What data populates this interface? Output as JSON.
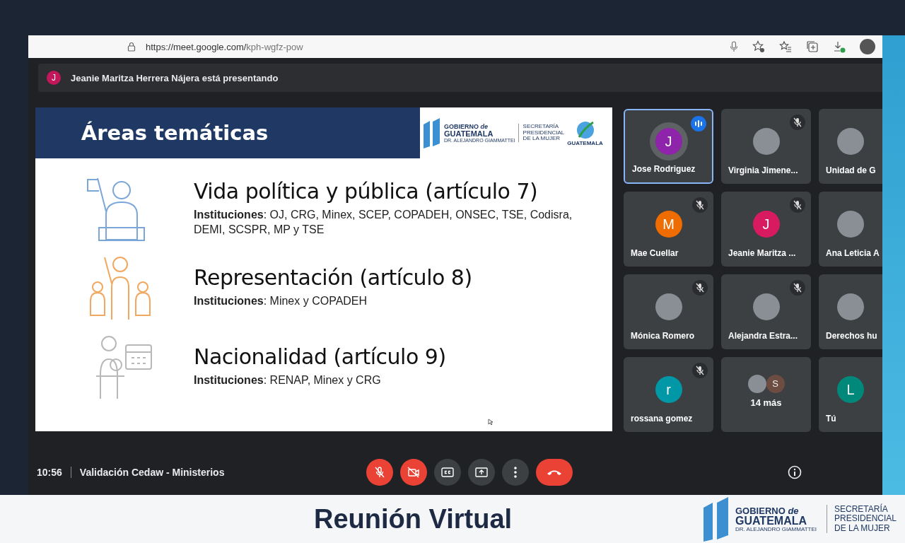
{
  "browser": {
    "url_host": "https://meet.google.com/",
    "url_path": "kph-wgfz-pow"
  },
  "presenter": {
    "initial": "J",
    "color": "#c2185b",
    "text": "Jeanie Maritza Herrera Nájera está presentando"
  },
  "slide": {
    "title": "Áreas temáticas",
    "logo": {
      "line1": "GOBIERNO *de*",
      "line2": "GUATEMALA",
      "line3": "DR. ALEJANDRO GIAMMATTEI",
      "secretaria": [
        "SECRETARÍA",
        "PRESIDENCIAL",
        "DE LA MUJER"
      ],
      "bicentenario": "GUATEMALA"
    },
    "topics": [
      {
        "kind": "politics",
        "heading": "Vida política y pública (artículo 7)",
        "institutions": "**Instituciones**: OJ, CRG, Minex, SCEP, COPADEH, ONSEC, TSE, Codisra, DEMI, SCSPR, MP y TSE"
      },
      {
        "kind": "representation",
        "heading": "Representación (artículo 8)",
        "institutions": "**Instituciones**: Minex y COPADEH"
      },
      {
        "kind": "nationality",
        "heading": "Nacionalidad (artículo 9)",
        "institutions": "**Instituciones**: RENAP, Minex y CRG"
      }
    ]
  },
  "tiles": [
    {
      "kind": "initial",
      "name": "Jose Rodriguez",
      "initial": "J",
      "color": "#8e24aa",
      "muted": false,
      "speaking": true,
      "selected": true
    },
    {
      "kind": "photo",
      "name": "Virginia Jimene...",
      "muted": true,
      "speaking": false,
      "selected": false
    },
    {
      "kind": "photo",
      "name": "Unidad de G",
      "muted": false,
      "speaking": false,
      "selected": false
    },
    {
      "kind": "initial",
      "name": "Mae Cuellar",
      "initial": "M",
      "color": "#ef6c00",
      "muted": true,
      "speaking": false,
      "selected": false
    },
    {
      "kind": "initial",
      "name": "Jeanie Maritza ...",
      "initial": "J",
      "color": "#d81b60",
      "muted": true,
      "speaking": false,
      "selected": false
    },
    {
      "kind": "photo",
      "name": "Ana Leticia A",
      "muted": false,
      "speaking": false,
      "selected": false
    },
    {
      "kind": "photo",
      "name": "Mónica Romero",
      "muted": true,
      "speaking": false,
      "selected": false
    },
    {
      "kind": "photo",
      "name": "Alejandra Estra...",
      "muted": true,
      "speaking": false,
      "selected": false
    },
    {
      "kind": "photo",
      "name": "Derechos hu",
      "muted": false,
      "speaking": false,
      "selected": false
    },
    {
      "kind": "initial",
      "name": "rossana gomez",
      "initial": "r",
      "color": "#0097a7",
      "muted": true,
      "speaking": false,
      "selected": false
    },
    {
      "kind": "more",
      "name": "14 más",
      "initial": "S",
      "color": "#6d4c41",
      "muted": false,
      "speaking": false,
      "selected": false
    },
    {
      "kind": "initial",
      "name": "Tú",
      "initial": "L",
      "color": "#00897b",
      "muted": false,
      "speaking": false,
      "selected": false
    }
  ],
  "meeting": {
    "time": "10:56",
    "title": "Validación Cedaw - Ministerios"
  },
  "controls": [
    {
      "kind": "mic",
      "off": true
    },
    {
      "kind": "camera",
      "off": true
    },
    {
      "kind": "captions",
      "off": false
    },
    {
      "kind": "present",
      "off": false
    },
    {
      "kind": "more",
      "off": false
    },
    {
      "kind": "hangup"
    }
  ],
  "footer": {
    "title": "Reunión Virtual",
    "logo": {
      "line1": "GOBIERNO *de*",
      "line2": "GUATEMALA",
      "line3": "DR. ALEJANDRO GIAMMATTEI",
      "secretaria": [
        "SECRETARÍA",
        "PRESIDENCIAL",
        "DE LA MUJER"
      ]
    }
  }
}
